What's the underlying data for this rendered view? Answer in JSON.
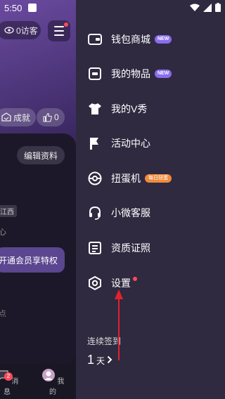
{
  "status_bar": {
    "time": "5:50"
  },
  "background_profile": {
    "visitors_label": "0访客",
    "achievement_label": "成就",
    "likes_count": "0",
    "edit_profile_label": "编辑资料",
    "location_tag": "江西",
    "small_text": "心",
    "vip_button_label": "开通会员享特权",
    "dim_text": "点",
    "tabs": [
      {
        "label": "消息",
        "badge": "2"
      },
      {
        "label": "我的"
      }
    ]
  },
  "drawer": {
    "items": [
      {
        "label": "钱包商城",
        "tag": "NEW"
      },
      {
        "label": "我的物品",
        "tag": "NEW"
      },
      {
        "label": "我的V秀"
      },
      {
        "label": "活动中心"
      },
      {
        "label": "扭蛋机",
        "tag": "每日扭蛋"
      },
      {
        "label": "小微客服"
      },
      {
        "label": "资质证照"
      },
      {
        "label": "设置"
      }
    ],
    "signin": {
      "label": "连续签到",
      "value": "1",
      "unit": "天"
    }
  },
  "colors": {
    "drawer_bg": "#2f2a40",
    "accent_new": "#8a6cf0",
    "accent_daily": "#f08a3c",
    "notice_red": "#ff4a5a",
    "annotation_arrow": "#e0222e"
  }
}
